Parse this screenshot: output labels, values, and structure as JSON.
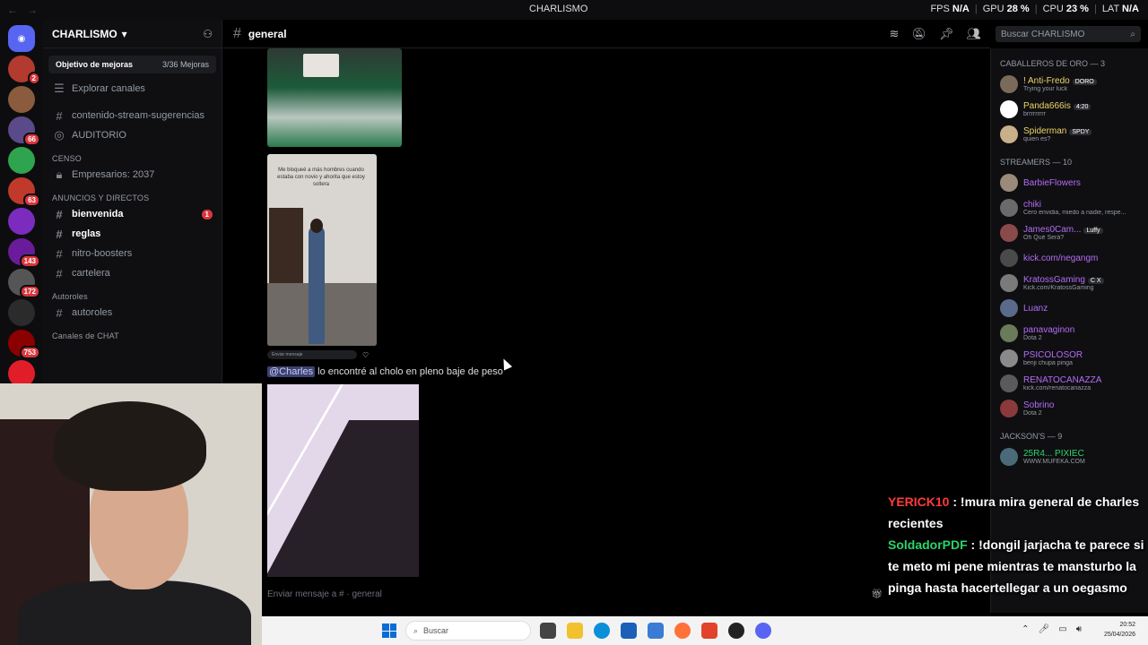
{
  "window": {
    "title": "CHARLISMO",
    "stats": [
      {
        "label": "FPS",
        "value": "N/A"
      },
      {
        "label": "GPU",
        "value": "28 %"
      },
      {
        "label": "CPU",
        "value": "23 %"
      },
      {
        "label": "LAT",
        "value": "N/A"
      }
    ]
  },
  "servers": [
    {
      "badge": "2",
      "color": "#b33a2e"
    },
    {
      "badge": "",
      "color": "#8a5b3d"
    },
    {
      "badge": "66",
      "color": "#5a4a8a"
    },
    {
      "badge": "",
      "color": "#2ea44f"
    },
    {
      "badge": "63",
      "color": "#c0392b"
    },
    {
      "badge": "",
      "color": "#7b2cbf"
    },
    {
      "badge": "143",
      "color": "#6a1b9a"
    },
    {
      "badge": "172",
      "color": "#555"
    },
    {
      "badge": "",
      "color": "#2b2b2b"
    },
    {
      "badge": "753",
      "color": "#8b0000"
    },
    {
      "badge": "",
      "color": "#e11d2a"
    }
  ],
  "sidebar": {
    "server_name": "CHARLISMO",
    "boost_label": "Objetivo de mejoras",
    "boost_count": "3/36 Mejoras",
    "browse": "Explorar canales",
    "top_channels": [
      {
        "name": "contenido-stream-sugerencias",
        "icon": "hash"
      },
      {
        "name": "AUDITORIO",
        "icon": "stage"
      }
    ],
    "cat_censo": "CENSO",
    "censo_channel": "Empresarios: 2037",
    "cat_anuncios": "ANUNCIOS Y DIRECTOS",
    "anuncios_channels": [
      {
        "name": "bienvenida",
        "unread": true,
        "badge": "1"
      },
      {
        "name": "reglas",
        "unread": true,
        "badge": ""
      },
      {
        "name": "nitro-boosters",
        "unread": false,
        "badge": ""
      },
      {
        "name": "cartelera",
        "unread": false,
        "badge": ""
      }
    ],
    "cat_autoroles": "Autoroles",
    "autoroles_channel": "autoroles",
    "cat_chat": "Canales de CHAT"
  },
  "chat": {
    "channel_name": "general",
    "search_placeholder": "Buscar CHARLISMO",
    "attachment_caption": "Me bloqueé a más hombres cuando estaba con novio y ahorita que estoy soltera",
    "reply_placeholder": "Enviar mensaje",
    "mention": "@Charles",
    "message_text": " lo encontré al cholo en pleno baje de peso",
    "composer_placeholder": "Enviar mensaje a #  · general"
  },
  "members": {
    "groups": [
      {
        "title": "CABALLEROS DE ORO — 3",
        "items": [
          {
            "name": "! Anti-Fredo",
            "tag": "DORO",
            "status": "Trying your luck",
            "color": "#f0d465",
            "av": "#7a6a5a"
          },
          {
            "name": "Panda666is",
            "tag": "4:20",
            "status": "brrrrrrrrr",
            "color": "#f0d465",
            "av": "#ffffff"
          },
          {
            "name": "Spiderman",
            "tag": "SPDY",
            "status": "quien es?",
            "color": "#f0d465",
            "av": "#c9b08a"
          }
        ]
      },
      {
        "title": "STREAMERS — 10",
        "items": [
          {
            "name": "BarbieFlowers",
            "tag": "",
            "status": "",
            "color": "#b56cf5",
            "av": "#9a8a7a"
          },
          {
            "name": "chiki",
            "tag": "",
            "status": "Cero envidia, miedo a nadie, respe...",
            "color": "#b56cf5",
            "av": "#6a6a6a"
          },
          {
            "name": "James0Cam...",
            "tag": "Luffy",
            "status": "Oh Qué Será?",
            "color": "#b56cf5",
            "av": "#8a4a4a"
          },
          {
            "name": "kick.com/negangm",
            "tag": "",
            "status": "",
            "color": "#b56cf5",
            "av": "#4a4a4a"
          },
          {
            "name": "KratossGaming",
            "tag": "C X",
            "status": "Kick.com/KratossGaming",
            "color": "#b56cf5",
            "av": "#7a7a7a"
          },
          {
            "name": "Luanz",
            "tag": "",
            "status": "",
            "color": "#b56cf5",
            "av": "#5a6a8a"
          },
          {
            "name": "panavaginon",
            "tag": "",
            "status": "Dota 2",
            "color": "#b56cf5",
            "av": "#6a7a5a"
          },
          {
            "name": "PSICOLOSOR",
            "tag": "",
            "status": "benji chupa pinga",
            "color": "#b56cf5",
            "av": "#8a8a8a"
          },
          {
            "name": "RENATOCANAZZA",
            "tag": "",
            "status": "kick.com/renatocanazza",
            "color": "#b56cf5",
            "av": "#5a5a5a"
          },
          {
            "name": "Sobrino",
            "tag": "",
            "status": "Dota 2",
            "color": "#b56cf5",
            "av": "#8a3a3a"
          }
        ]
      },
      {
        "title": "JACKSON'S — 9",
        "items": [
          {
            "name": "25R4... PIXIEC",
            "tag": "",
            "status": "WWW.MUFEKA.COM",
            "color": "#2bd46b",
            "av": "#4a6a7a"
          }
        ]
      }
    ]
  },
  "overlay": {
    "messages": [
      {
        "user": "YERICK10",
        "text": " : !mura mira general de charles recientes",
        "kind": "u1"
      },
      {
        "user": "SoldadorPDF",
        "text": " : !dongil jarjacha te parece si te meto mi pene mientras te mansturbo la pinga hasta hacertellegar a un oegasmo",
        "kind": "u2"
      }
    ]
  },
  "taskbar": {
    "search": "Buscar",
    "time": "20:52",
    "date": "25/04/2026"
  }
}
